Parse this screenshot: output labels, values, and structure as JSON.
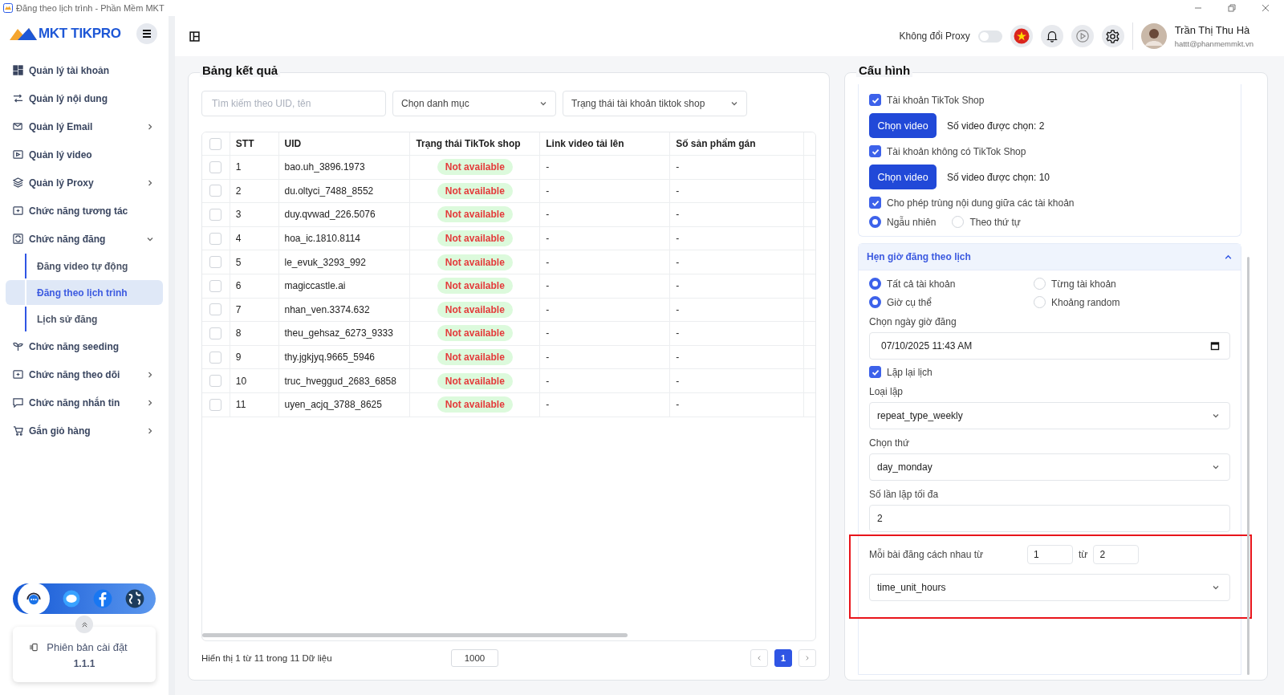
{
  "window": {
    "title": "Đăng theo lịch trình - Phần Mềm MKT"
  },
  "sidebar": {
    "logo": "MKT TIKPRO",
    "items": [
      {
        "kind": "link",
        "label": "Quản lý tài khoản",
        "selected": false
      },
      {
        "kind": "link",
        "label": "Quản lý nội dung",
        "selected": false
      },
      {
        "kind": "group",
        "label": "Quản lý Email",
        "selected": false,
        "expanded": false
      },
      {
        "kind": "link",
        "label": "Quản lý video",
        "selected": false
      },
      {
        "kind": "group",
        "label": "Quản lý Proxy",
        "selected": false,
        "expanded": false
      },
      {
        "kind": "link",
        "label": "Chức năng tương tác",
        "selected": false
      },
      {
        "kind": "group",
        "label": "Chức năng đăng",
        "selected": false,
        "expanded": true,
        "children": [
          {
            "label": "Đăng video tự động",
            "selected": false
          },
          {
            "label": "Đăng theo lịch trình",
            "selected": true
          },
          {
            "label": "Lịch sử đăng",
            "selected": false
          }
        ]
      },
      {
        "kind": "link",
        "label": "Chức năng seeding",
        "selected": false
      },
      {
        "kind": "group",
        "label": "Chức năng theo dõi",
        "selected": false,
        "expanded": false
      },
      {
        "kind": "group",
        "label": "Chức năng nhắn tin",
        "selected": false,
        "expanded": false
      },
      {
        "kind": "group",
        "label": "Gắn giỏ hàng",
        "selected": false,
        "expanded": false
      }
    ],
    "version": {
      "label": "Phiên bản cài đặt",
      "value": "1.1.1"
    }
  },
  "header": {
    "proxy_label": "Không đổi Proxy",
    "proxy_on": false,
    "user": {
      "name": "Trần Thị Thu Hà",
      "email": "hattt@phanmemmkt.vn"
    }
  },
  "results": {
    "title": "Bảng kết quả",
    "search_placeholder": "Tìm kiếm theo UID, tên",
    "filters": [
      "Chọn danh mục",
      "Trạng thái tài khoản tiktok shop"
    ],
    "columns": [
      "STT",
      "UID",
      "Trạng thái TikTok shop",
      "Link video tải lên",
      "Số sản phẩm gán"
    ],
    "rows": [
      {
        "checked": false,
        "stt": "1",
        "uid": "bao.uh_3896.1973",
        "status": "Not available",
        "link": "-",
        "products": "-"
      },
      {
        "checked": false,
        "stt": "2",
        "uid": "du.oltyci_7488_8552",
        "status": "Not available",
        "link": "-",
        "products": "-"
      },
      {
        "checked": false,
        "stt": "3",
        "uid": "duy.qvwad_226.5076",
        "status": "Not available",
        "link": "-",
        "products": "-"
      },
      {
        "checked": false,
        "stt": "4",
        "uid": "hoa_ic.1810.8114",
        "status": "Not available",
        "link": "-",
        "products": "-"
      },
      {
        "checked": false,
        "stt": "5",
        "uid": "le_evuk_3293_992",
        "status": "Not available",
        "link": "-",
        "products": "-"
      },
      {
        "checked": false,
        "stt": "6",
        "uid": "magiccastle.ai",
        "status": "Not available",
        "link": "-",
        "products": "-"
      },
      {
        "checked": false,
        "stt": "7",
        "uid": "nhan_ven.3374.632",
        "status": "Not available",
        "link": "-",
        "products": "-"
      },
      {
        "checked": false,
        "stt": "8",
        "uid": "theu_gehsaz_6273_9333",
        "status": "Not available",
        "link": "-",
        "products": "-"
      },
      {
        "checked": false,
        "stt": "9",
        "uid": "thy.jgkjyq.9665_5946",
        "status": "Not available",
        "link": "-",
        "products": "-"
      },
      {
        "checked": false,
        "stt": "10",
        "uid": "truc_hveggud_2683_6858",
        "status": "Not available",
        "link": "-",
        "products": "-"
      },
      {
        "checked": false,
        "stt": "11",
        "uid": "uyen_acjq_3788_8625",
        "status": "Not available",
        "link": "-",
        "products": "-"
      }
    ],
    "all_checked": false,
    "footer": "Hiển thị 1 từ 11 trong 11 Dữ liệu",
    "page_size": "1000",
    "pages": [
      {
        "label": "1",
        "selected": true
      }
    ]
  },
  "config": {
    "title": "Cấu hình",
    "options": [
      {
        "kind": "checkbox",
        "label": "Tài khoản TikTok Shop",
        "checked": true
      },
      {
        "kind": "video",
        "button": "Chọn video",
        "count": "Số video được chọn: 2"
      },
      {
        "kind": "checkbox",
        "label": "Tài khoản không có TikTok Shop",
        "checked": true
      },
      {
        "kind": "video",
        "button": "Chọn video",
        "count": "Số video được chọn: 10"
      },
      {
        "kind": "checkbox",
        "label": "Cho phép trùng nội dung giữa các tài khoản",
        "checked": true
      },
      {
        "kind": "radios",
        "options": [
          {
            "label": "Ngẫu nhiên",
            "selected": true
          },
          {
            "label": "Theo thứ tự",
            "selected": false
          }
        ]
      }
    ],
    "schedule": {
      "title": "Hẹn giờ đăng theo lịch",
      "expanded": true,
      "items": [
        {
          "kind": "radios",
          "options": [
            {
              "label": "Tất cả tài khoản",
              "selected": true
            },
            {
              "label": "Từng tài khoản",
              "selected": false
            }
          ]
        },
        {
          "kind": "radios",
          "options": [
            {
              "label": "Giờ cụ thể",
              "selected": true
            },
            {
              "label": "Khoảng random",
              "selected": false
            }
          ]
        },
        {
          "kind": "date",
          "label": "Chọn ngày giờ đăng",
          "value": "07/10/2025 11:43 AM"
        },
        {
          "kind": "checkbox",
          "label": "Lặp lại lịch",
          "checked": true
        },
        {
          "kind": "select",
          "label": "Loại lặp",
          "value": "repeat_type_weekly"
        },
        {
          "kind": "select",
          "label": "Chọn thứ",
          "value": "day_monday"
        },
        {
          "kind": "input",
          "label": "Số lần lặp tối đa",
          "value": "2"
        },
        {
          "kind": "range",
          "label": "Mỗi bài đăng cách nhau từ",
          "from": "1",
          "joiner": "từ",
          "to": "2",
          "unit": "time_unit_hours",
          "highlighted": true
        }
      ]
    }
  }
}
